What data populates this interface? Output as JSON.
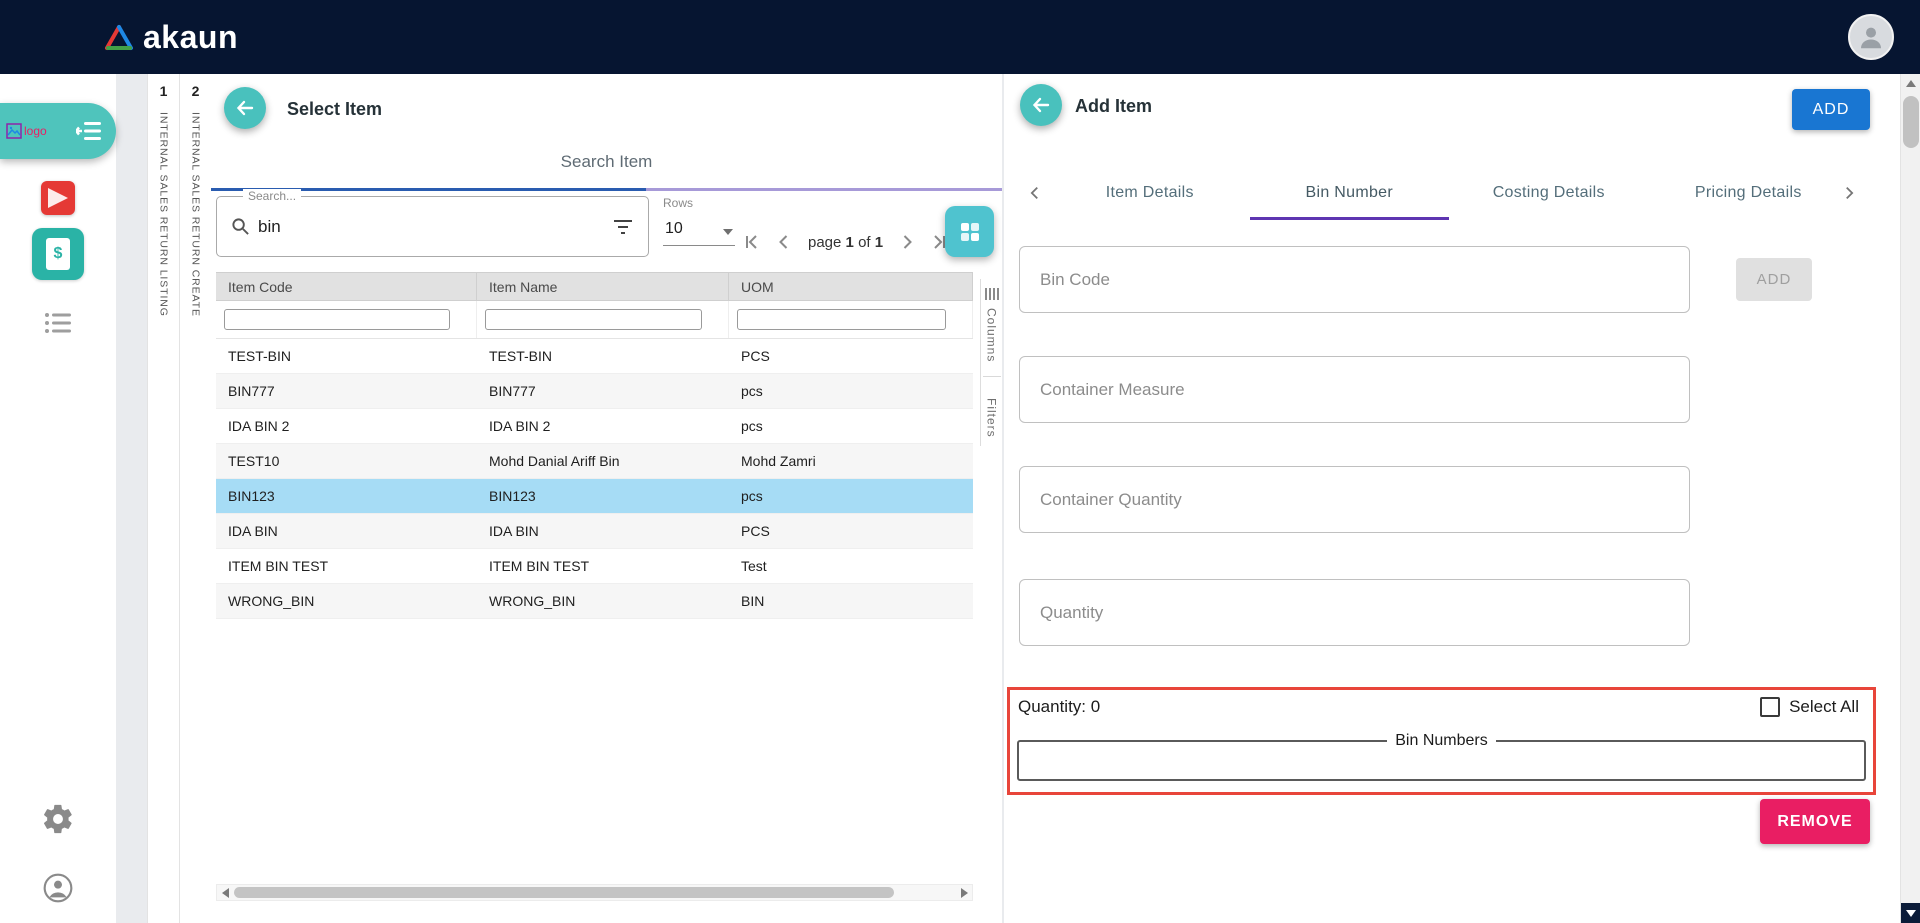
{
  "topbar": {
    "brand": "akaun"
  },
  "sidebar": {
    "logo_alt": "logo"
  },
  "vertical_tabs": [
    {
      "num": "1",
      "label": "INTERNAL SALES RETURN LISTING"
    },
    {
      "num": "2",
      "label": "INTERNAL SALES RETURN CREATE"
    }
  ],
  "select_item": {
    "title": "Select Item",
    "tab_label": "Search Item",
    "search": {
      "label": "Search...",
      "value": "bin"
    },
    "rows": {
      "label": "Rows",
      "value": "10"
    },
    "pagination": {
      "page_word": "page",
      "current": "1",
      "of_word": "of",
      "total": "1"
    },
    "table": {
      "headers": [
        "Item Code",
        "Item Name",
        "UOM"
      ],
      "rows": [
        [
          "TEST-BIN",
          "TEST-BIN",
          "PCS"
        ],
        [
          "BIN777",
          "BIN777",
          "pcs"
        ],
        [
          "IDA BIN 2",
          "IDA BIN 2",
          "pcs"
        ],
        [
          "TEST10",
          "Mohd Danial Ariff Bin",
          "Mohd Zamri"
        ],
        [
          "BIN123",
          "BIN123",
          "pcs"
        ],
        [
          "IDA BIN",
          "IDA BIN",
          "PCS"
        ],
        [
          "ITEM BIN TEST",
          "ITEM BIN TEST",
          "Test"
        ],
        [
          "WRONG_BIN",
          "WRONG_BIN",
          "BIN"
        ]
      ],
      "selected_row_index": 4
    },
    "side_controls": {
      "columns": "Columns",
      "filters": "Filters"
    }
  },
  "add_item": {
    "title": "Add Item",
    "add_button": "ADD",
    "tabs": [
      "Item Details",
      "Bin Number",
      "Costing Details",
      "Pricing Details"
    ],
    "active_tab_index": 1,
    "fields": [
      "Bin Code",
      "Container Measure",
      "Container Quantity",
      "Quantity"
    ],
    "bin_code_add_button": "ADD",
    "quantity_summary": "Quantity: 0",
    "select_all_label": "Select All",
    "bin_numbers_legend": "Bin Numbers",
    "remove_button": "REMOVE"
  },
  "colors": {
    "topbar_navy": "#061531",
    "accent_teal": "#49c1bd",
    "primary_blue": "#1976d2",
    "remove_pink": "#e91e63",
    "tab_indicator_purple": "#5e35b1",
    "selected_row_blue": "#a6dcf5",
    "alert_red": "#e8453a"
  }
}
